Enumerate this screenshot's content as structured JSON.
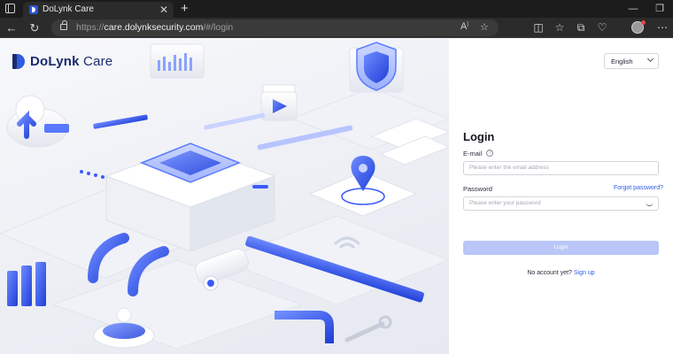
{
  "browser": {
    "tab_title": "DoLynk Care",
    "tab_close": "✕",
    "new_tab": "+",
    "url_scheme": "https://",
    "url_host": "care.dolynksecurity.com",
    "url_path": "/#/login",
    "icons": [
      "window-menu-icon",
      "back-icon",
      "refresh-icon",
      "lock-icon",
      "read-aloud-icon",
      "favorite-star-icon",
      "split-screen-icon",
      "favorites-icon",
      "collections-icon",
      "heart-health-icon",
      "profile-avatar-icon",
      "more-icon",
      "minimize-icon",
      "maximize-icon"
    ]
  },
  "brand": {
    "name_bold": "DoLynk",
    "name_thin": "Care"
  },
  "login": {
    "language": "English",
    "title": "Login",
    "email_label": "E-mail",
    "email_placeholder": "Please enter the email address",
    "password_label": "Password",
    "forgot_link": "Forgot password?",
    "password_placeholder": "Please enter your password",
    "submit_label": "Login",
    "no_account_text": "No account yet?",
    "signup_link": "Sign up"
  },
  "colors": {
    "accent": "#2f5de0",
    "button_disabled": "#b9c6f7",
    "brand_dark": "#1b2a6b"
  }
}
